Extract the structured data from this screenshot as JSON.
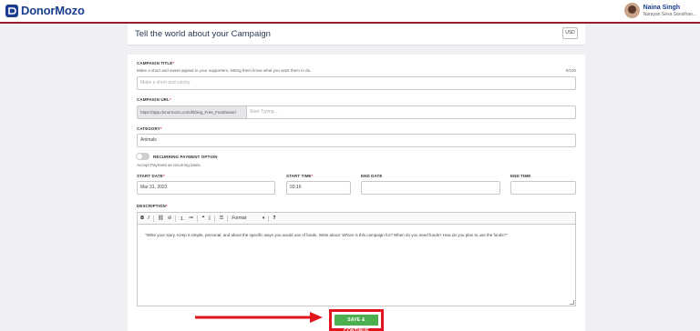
{
  "app": {
    "logo_text": "DonorMozo"
  },
  "user": {
    "name": "Naina Singh",
    "org": "Narayan Seva Sansthan..."
  },
  "header": {
    "title": "Tell the world about your Campaign",
    "currency": "USD"
  },
  "form": {
    "campaign_title": {
      "label": "CAMPAIGN TITLE",
      "required": "*",
      "hint": "Make a short and sweet appeal to your supporters, letting them know what you want them to do.",
      "counter": "0/100",
      "placeholder": "Make a short and catchy"
    },
    "campaign_url": {
      "label": "CAMPAIGN URL",
      "required": "*",
      "prefix": "https://app.donormozo.com/kf/ang_Free_Fundraiser/",
      "placeholder": "Start Typing..."
    },
    "category": {
      "label": "CATEGORY",
      "required": "*",
      "value": "Animals"
    },
    "recurring": {
      "label": "RECURRING PAYMENT OPTION",
      "hint": "Accept Payment as recurring basis."
    },
    "start_date": {
      "label": "START DATE",
      "required": "*",
      "value": "Mar 31, 2023"
    },
    "start_time": {
      "label": "START TIME",
      "required": "*",
      "value": "03:16"
    },
    "end_date": {
      "label": "END DATE",
      "value": ""
    },
    "end_time": {
      "label": "END TIME",
      "value": ""
    },
    "description": {
      "label": "DESCRIPTION",
      "required": "*",
      "toolbar": {
        "bold": "B",
        "italic": "I",
        "link": "⛓",
        "unlink": "⊘",
        "ordered_list": "⒈",
        "bullet_list": "≔",
        "quote": "❝",
        "code": "▯",
        "align": "☰",
        "format": "Format",
        "format_arrow": "▾",
        "help": "?"
      },
      "body": "\"Write your story. Keep it simple, personal, and about the specific ways you would use of funds. Write about: Whom is this campaign for? When do you need funds? How do you plan to use the funds?\""
    },
    "save_button": "SAVE & CONTINUE"
  },
  "colors": {
    "brand": "#1a3d8f",
    "accent_red": "#e1141e",
    "button_green": "#4caf50"
  }
}
